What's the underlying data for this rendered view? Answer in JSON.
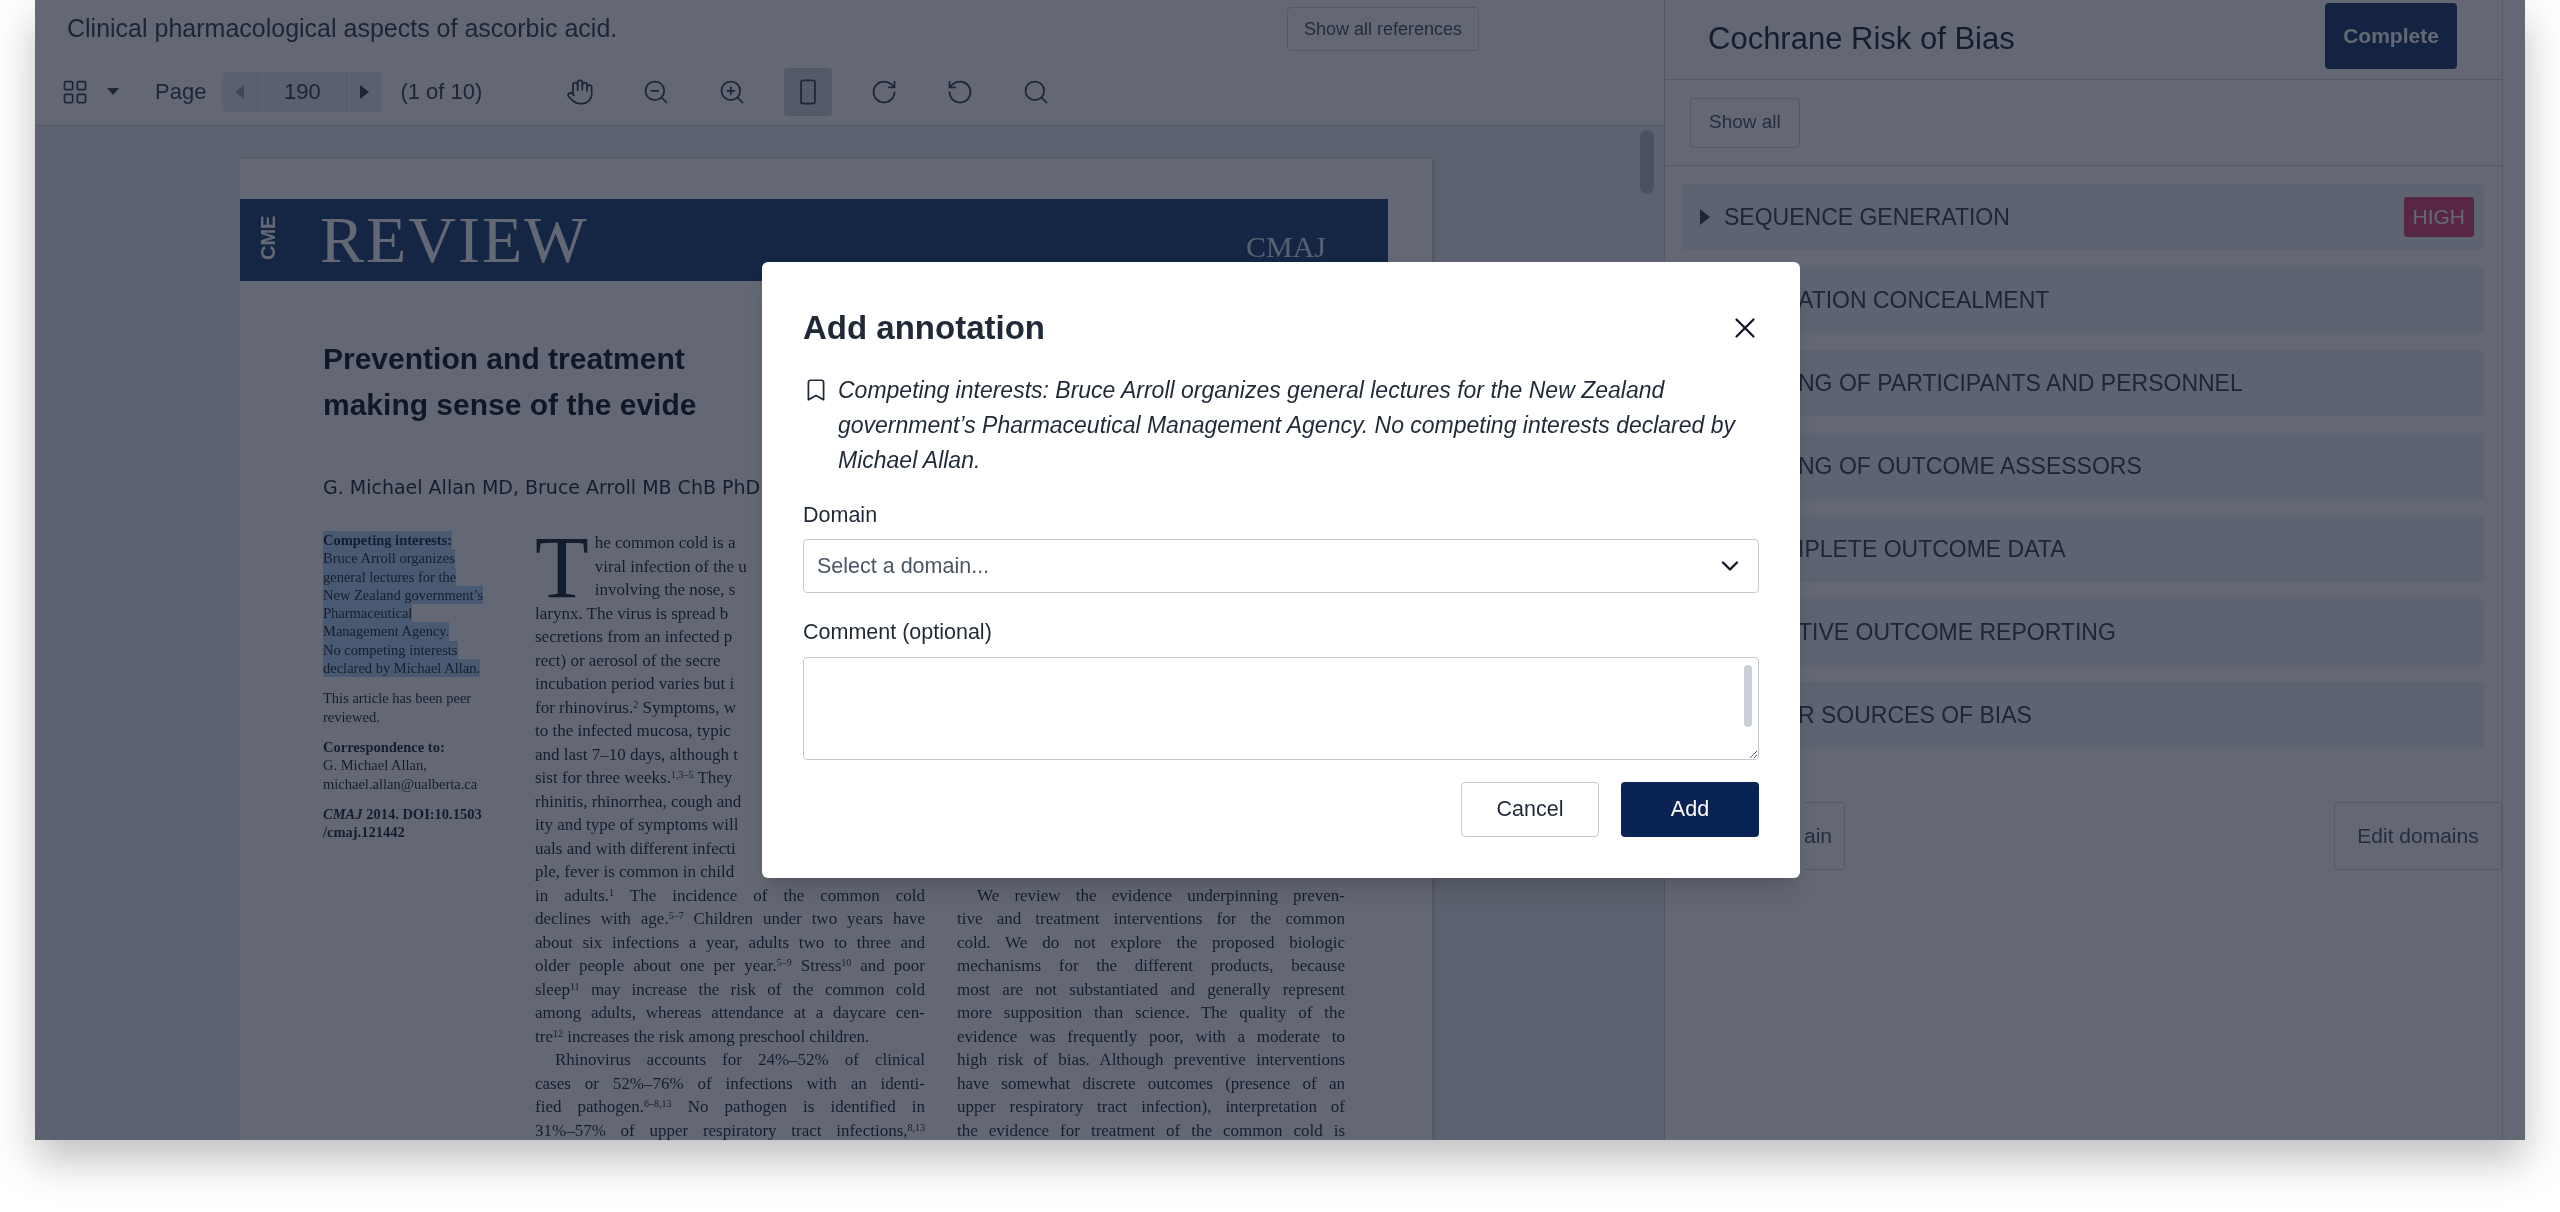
{
  "document_title": "Clinical pharmacological aspects of ascorbic acid.",
  "references_button": "Show all references",
  "toolbar": {
    "page_label": "Page",
    "page": "190",
    "page_count": "(1 of 10)",
    "previous_disabled": true,
    "next_disabled": false,
    "tools": [
      {
        "kind": "pan",
        "selected": false
      },
      {
        "kind": "zoom_out",
        "selected": false
      },
      {
        "kind": "zoom_in",
        "selected": false
      },
      {
        "kind": "fit_page",
        "selected": true
      },
      {
        "kind": "rotate_clockwise",
        "selected": false
      },
      {
        "kind": "rotate_counterclockwise",
        "selected": false
      },
      {
        "kind": "search",
        "selected": false
      }
    ]
  },
  "pdf": {
    "banner": {
      "section": "CME",
      "title": "REVIEW",
      "journal": "CMAJ"
    },
    "title_lines": [
      "Prevention and treatment",
      "making sense of the evide"
    ],
    "authors": "G. Michael Allan MD, Bruce Arroll MB ChB PhD",
    "sidebar": [
      {
        "heading": "Competing interests:",
        "highlighted": true,
        "bold": false,
        "lines": [
          "Bruce Arroll organizes",
          "general lectures for the",
          "New Zealand government’s",
          "Pharmaceutical",
          "Management Agency.",
          "No competing interests",
          "declared by Michael Allan."
        ]
      },
      {
        "highlighted": false,
        "bold": false,
        "lines": [
          "This article has been peer",
          "reviewed."
        ]
      },
      {
        "heading": "Correspondence to:",
        "highlighted": false,
        "bold": false,
        "lines": [
          "G. Michael Allan,",
          "michael.allan@ualberta.ca"
        ]
      },
      {
        "highlighted": false,
        "bold": true,
        "lines": [
          "*CMAJ* 2014. DOI:10.1503",
          "/cmaj.121442"
        ]
      }
    ],
    "body_left": {
      "drop_cap": "T",
      "drop_cap_lines": [
        "he common cold is a",
        "viral infection of the u",
        "involving the nose, s"
      ],
      "lines": [
        {
          "text": "larynx. The virus is spread b",
          "kind": "ragged",
          "indent": false
        },
        {
          "text": "secretions from an infected p",
          "kind": "ragged",
          "indent": false
        },
        {
          "text": "rect) or aerosol of the secre",
          "kind": "ragged",
          "indent": false
        },
        {
          "text": "incubation period varies but i",
          "kind": "ragged",
          "indent": false
        },
        {
          "text": "for rhinovirus.$^{2}$ Symptoms, w",
          "kind": "ragged",
          "indent": false
        },
        {
          "text": "to the infected mucosa, typic",
          "kind": "ragged",
          "indent": false
        },
        {
          "text": "and last 7–10 days, although t",
          "kind": "ragged",
          "indent": false
        },
        {
          "text": "sist for three weeks.$^{1,3–5}$ They",
          "kind": "ragged",
          "indent": false
        },
        {
          "text": "rhinitis, rhinorrhea, cough and",
          "kind": "ragged",
          "indent": false
        },
        {
          "text": "ity and type of symptoms will",
          "kind": "ragged",
          "indent": false
        },
        {
          "text": "uals and with different infecti",
          "kind": "ragged",
          "indent": false
        },
        {
          "text": "ple, fever is common in child",
          "kind": "ragged",
          "indent": false
        },
        {
          "text": "in adults.$^{1}$ The incidence of the common cold",
          "kind": "justified",
          "indent": false
        },
        {
          "text": "declines with age.$^{5–7}$ Children under two years have",
          "kind": "justified",
          "indent": false
        },
        {
          "text": "about six infections a year, adults two to three and",
          "kind": "justified",
          "indent": false
        },
        {
          "text": "older people about one per year.$^{5–9}$ Stress$^{10}$ and poor",
          "kind": "justified",
          "indent": false
        },
        {
          "text": "sleep$^{11}$ may increase the risk of the common cold",
          "kind": "justified",
          "indent": false
        },
        {
          "text": "among adults, whereas attendance at a daycare cen-",
          "kind": "justified",
          "indent": false
        },
        {
          "text": "tre$^{12}$ increases the risk among preschool children.",
          "kind": "ragged",
          "indent": false
        },
        {
          "text": "Rhinovirus accounts for 24%–52% of clinical",
          "kind": "justified",
          "indent": true
        },
        {
          "text": "cases or 52%–76% of infections with an identi-",
          "kind": "justified",
          "indent": false
        },
        {
          "text": "fied pathogen.$^{6–8,13}$ No pathogen is identified in",
          "kind": "justified",
          "indent": false
        },
        {
          "text": "31%–57% of upper respiratory tract infections,$^{8,13}$",
          "kind": "justified",
          "indent": false
        }
      ]
    },
    "body_right": {
      "lines": [
        {
          "text": "We review the evidence underpinning preven-",
          "kind": "justified",
          "indent": true
        },
        {
          "text": "tive and treatment interventions for the common",
          "kind": "justified",
          "indent": false
        },
        {
          "text": "cold. We do not explore the proposed biologic",
          "kind": "justified",
          "indent": false
        },
        {
          "text": "mechanisms for the different products, because",
          "kind": "justified",
          "indent": false
        },
        {
          "text": "most are not substantiated and generally represent",
          "kind": "justified",
          "indent": false
        },
        {
          "text": "more supposition than science. The quality of the",
          "kind": "justified",
          "indent": false
        },
        {
          "text": "evidence was frequently poor, with a moderate to",
          "kind": "justified",
          "indent": false
        },
        {
          "text": "high risk of bias. Although preventive interventions",
          "kind": "justified",
          "indent": false
        },
        {
          "text": "have somewhat discrete outcomes (presence of an",
          "kind": "justified",
          "indent": false
        },
        {
          "text": "upper respiratory tract infection), interpretation of",
          "kind": "justified",
          "indent": false
        },
        {
          "text": "the evidence for treatment of the common cold is",
          "kind": "justified",
          "indent": false
        }
      ]
    }
  },
  "risk_panel": {
    "title": "Cochrane Risk of Bias",
    "complete_button": "Complete",
    "show_all_button": "Show all",
    "domains": [
      {
        "label": "SEQUENCE GENERATION",
        "covered": false,
        "badge": "HIGH",
        "alert": true
      },
      {
        "label": "ATION CONCEALMENT",
        "covered": true
      },
      {
        "label": "NG OF PARTICIPANTS AND PERSONNEL",
        "covered": true
      },
      {
        "label": "NG OF OUTCOME ASSESSORS",
        "covered": true
      },
      {
        "label": "IPLETE OUTCOME DATA",
        "covered": true
      },
      {
        "label": "TIVE OUTCOME REPORTING",
        "covered": true
      },
      {
        "label": "R SOURCES OF BIAS",
        "covered": true
      }
    ],
    "buttons": [
      {
        "label": "ain",
        "covered": true
      },
      {
        "label": "Edit domains",
        "covered": false
      }
    ]
  },
  "dialog": {
    "title": "Add annotation",
    "quote": "Competing interests: Bruce Arroll organizes general lectures for the New Zealand government’s Pharmaceutical Management Agency. No competing interests declared by Michael Allan.",
    "domain_label": "Domain",
    "domain_select": {
      "placeholder": "Select a domain..."
    },
    "comment_label": "Comment (optional)",
    "buttons": [
      {
        "label": "Cancel",
        "kind": "secondary"
      },
      {
        "label": "Add",
        "kind": "primary"
      }
    ]
  }
}
